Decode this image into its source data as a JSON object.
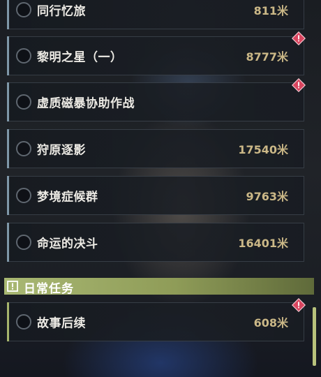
{
  "quests": [
    {
      "name": "同行忆旅",
      "distance": "811米",
      "alert": false
    },
    {
      "name": "黎明之星（一）",
      "distance": "8777米",
      "alert": true
    },
    {
      "name": "虚质磁暴协助作战",
      "distance": "",
      "alert": true
    },
    {
      "name": "狩原逐影",
      "distance": "17540米",
      "alert": false
    },
    {
      "name": "梦境症候群",
      "distance": "9763米",
      "alert": false
    },
    {
      "name": "命运的决斗",
      "distance": "16401米",
      "alert": false
    }
  ],
  "daily_section": {
    "title": "日常任务",
    "icon": "alert-box-icon",
    "quests": [
      {
        "name": "故事后续",
        "distance": "608米",
        "alert": true
      }
    ]
  },
  "colors": {
    "distance": "#cbb887",
    "alert": "#d9455f",
    "section_bg": "#a9b873"
  }
}
